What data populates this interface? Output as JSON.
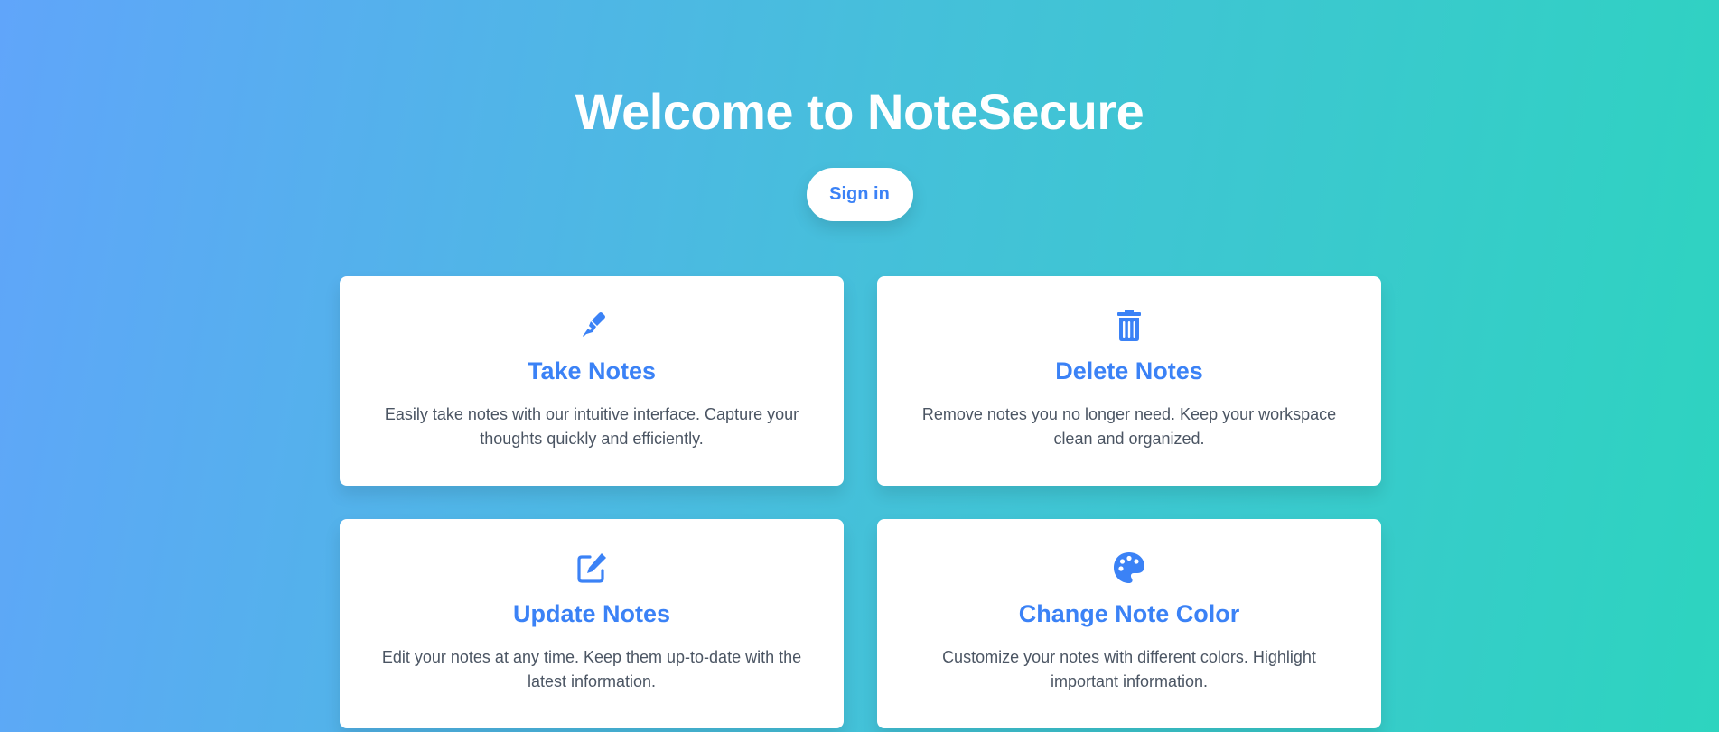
{
  "hero": {
    "title": "Welcome to NoteSecure",
    "signin_label": "Sign in"
  },
  "colors": {
    "accent": "#3b82f6",
    "gradient_start": "#60a5fa",
    "gradient_end": "#2dd4bf",
    "card_text": "#4b5563"
  },
  "features": [
    {
      "icon": "pen-icon",
      "title": "Take Notes",
      "description": "Easily take notes with our intuitive interface. Capture your thoughts quickly and efficiently."
    },
    {
      "icon": "trash-icon",
      "title": "Delete Notes",
      "description": "Remove notes you no longer need. Keep your workspace clean and organized."
    },
    {
      "icon": "edit-icon",
      "title": "Update Notes",
      "description": "Edit your notes at any time. Keep them up-to-date with the latest information."
    },
    {
      "icon": "palette-icon",
      "title": "Change Note Color",
      "description": "Customize your notes with different colors. Highlight important information."
    }
  ]
}
